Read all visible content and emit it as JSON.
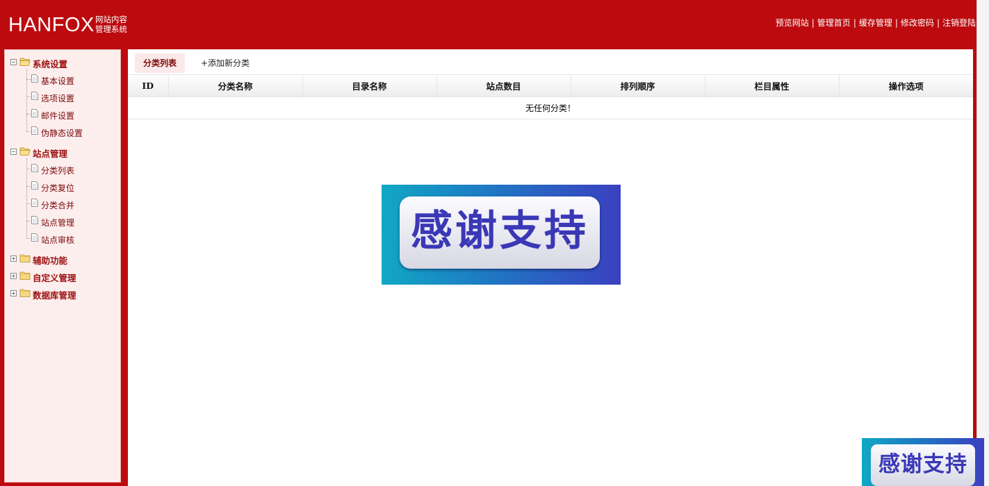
{
  "header": {
    "logo_text": "HANFOX",
    "logo_sub_line1": "网站内容",
    "logo_sub_line2": "管理系统",
    "nav": [
      "预览网站",
      "管理首页",
      "缓存管理",
      "修改密码",
      "注销登陆"
    ],
    "separator": "|"
  },
  "sidebar": {
    "groups": [
      {
        "label": "系统设置",
        "expanded": true,
        "expander": "−",
        "items": [
          "基本设置",
          "选项设置",
          "邮件设置",
          "伪静态设置"
        ]
      },
      {
        "label": "站点管理",
        "expanded": true,
        "expander": "−",
        "items": [
          "分类列表",
          "分类复位",
          "分类合并",
          "站点管理",
          "站点审核"
        ]
      },
      {
        "label": "辅助功能",
        "expanded": false,
        "expander": "+",
        "items": []
      },
      {
        "label": "自定义管理",
        "expanded": false,
        "expander": "+",
        "items": []
      },
      {
        "label": "数据库管理",
        "expanded": false,
        "expander": "+",
        "items": []
      }
    ]
  },
  "tabs": {
    "active": "分类列表",
    "add": "+添加新分类"
  },
  "table": {
    "columns": [
      "ID",
      "分类名称",
      "目录名称",
      "站点数目",
      "排列顺序",
      "栏目属性",
      "操作选项"
    ],
    "empty_message": "无任何分类！"
  },
  "banners": {
    "text": "感谢支持"
  },
  "colors": {
    "header_red": "#bc0a0e",
    "sidebar_bg": "#fdeeee",
    "link_dark_red": "#7a0a0a",
    "banner_text": "#3a38b6"
  }
}
